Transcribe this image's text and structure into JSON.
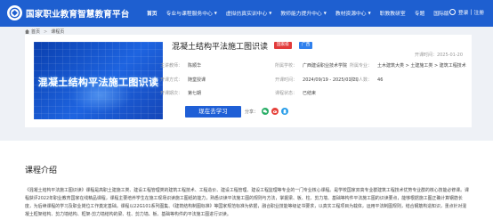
{
  "header": {
    "site_title": "国家职业教育智慧教育平台",
    "nav": [
      {
        "label": "首页",
        "has_menu": false
      },
      {
        "label": "专业与课程服务中心",
        "has_menu": true
      },
      {
        "label": "虚拟仿真实训中心",
        "has_menu": true
      },
      {
        "label": "教师能力提升中心",
        "has_menu": true
      },
      {
        "label": "教材资源中心",
        "has_menu": true
      },
      {
        "label": "职教教研室",
        "has_menu": false
      },
      {
        "label": "专题",
        "has_menu": false
      },
      {
        "label": "国际版",
        "has_menu": false
      }
    ],
    "login": "登录",
    "register": "注册"
  },
  "breadcrumb": {
    "home": "首页",
    "current": "课程页"
  },
  "course": {
    "cover_title": "混凝土结构平法施工图识读",
    "title": "混凝土结构平法施工图识读",
    "badge_hot": "国家级",
    "badge_type": "广西",
    "start_date": "开课时间：2025-01-20",
    "info": {
      "teacher_label": "主讲教师：",
      "teacher": "陈顺华",
      "school_label": "所属学校：",
      "school": "广西建设职业技术学院",
      "major_label": "所属专业：",
      "major": "土木建筑大类 > 土建施工类 > 建筑工程技术",
      "mode_label": "开课方式：",
      "mode": "随堂授课",
      "time_label": "开课时间：",
      "time": "2024/09/19 - 2025/01/20",
      "learners_label": "学习人数：",
      "learners": "46",
      "session_label": "开课期次：",
      "session": "第七期",
      "status_label": "课程状态：",
      "status": "已结束"
    },
    "study_button": "现在去学习",
    "share_label": "分享："
  },
  "intro": {
    "title": "课程介绍",
    "text": "《混凝土结构平法施工图识读》课程是高职土建施工类、建设工程管理类的建筑工程技术、工程造价、建设工程管理、建设工程监理等专业的一门专业核心课程。是学校国家双高专业群建筑工程技术优势专业群的核心技能必修课。课程获评2022年职业教育国家在线精品课程，课程主要培养学生在施工现场识读施工图纸的能力，熟悉识读平法施工图的规则与方法，掌握梁、板、柱、剪力墙、基础等构件平法施工图的识读要点，能够根据施工图正确计算钢筋长度，为后续课程的学习及职业岗位工作奠定基础。课程以22G101系列图集、《建筑结构制图标准》等国家规范标准为依据，融合职业技能等级证书要求，以真实工程项目为载体，运用平法制图规则，结合钢筋构造知识，重点针对混凝土框架结构、剪力墙结构、框架-剪力墙结构的梁、柱、剪力墙、板、基础等构件的平法施工图进行识读。"
  },
  "colors": {
    "primary": "#1e5fd0",
    "badge_red": "#e23b3b",
    "badge_blue": "#2f80ed"
  }
}
